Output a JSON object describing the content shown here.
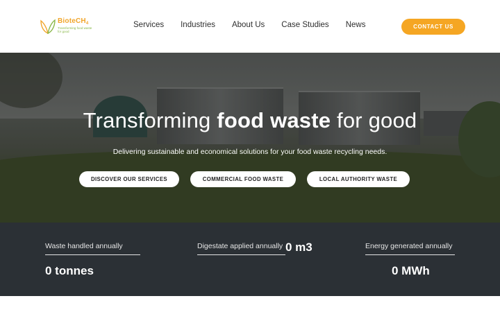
{
  "header": {
    "logo": {
      "name_main": "BioteCH",
      "name_sub": "4",
      "tagline": "Transforming food waste for good"
    },
    "nav": [
      {
        "label": "Services"
      },
      {
        "label": "Industries"
      },
      {
        "label": "About Us"
      },
      {
        "label": "Case Studies"
      },
      {
        "label": "News"
      }
    ],
    "cta_label": "CONTACT US"
  },
  "hero": {
    "title_prefix": "Transforming ",
    "title_bold": "food waste",
    "title_suffix": " for good",
    "subtitle": "Delivering sustainable and economical solutions for your food waste recycling needs.",
    "buttons": [
      {
        "label": "DISCOVER OUR SERVICES"
      },
      {
        "label": "COMMERCIAL FOOD WASTE"
      },
      {
        "label": "LOCAL AUTHORITY WASTE"
      }
    ]
  },
  "stats": [
    {
      "label": "Waste handled annually",
      "value": "0 tonnes"
    },
    {
      "label": "Digestate applied annually",
      "value": "0 m3"
    },
    {
      "label": "Energy generated annually",
      "value": "0 MWh"
    }
  ],
  "colors": {
    "accent": "#f5a623",
    "logo_green": "#8ab84a",
    "stats_bg": "#2b3035"
  }
}
